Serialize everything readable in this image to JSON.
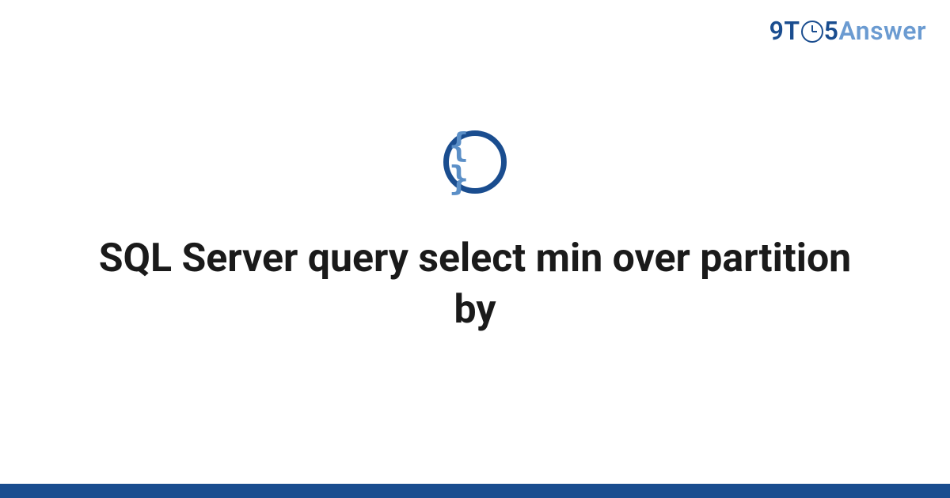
{
  "header": {
    "logo": {
      "part1": "9T",
      "part2": "5",
      "part3": "Answer"
    }
  },
  "icon": {
    "symbol": "{ }",
    "name": "code-braces"
  },
  "main": {
    "title": "SQL Server query select min over partition by"
  },
  "colors": {
    "primary": "#1a4d8f",
    "secondary": "#6b9bd1",
    "icon_inner": "#5b8fc7"
  }
}
